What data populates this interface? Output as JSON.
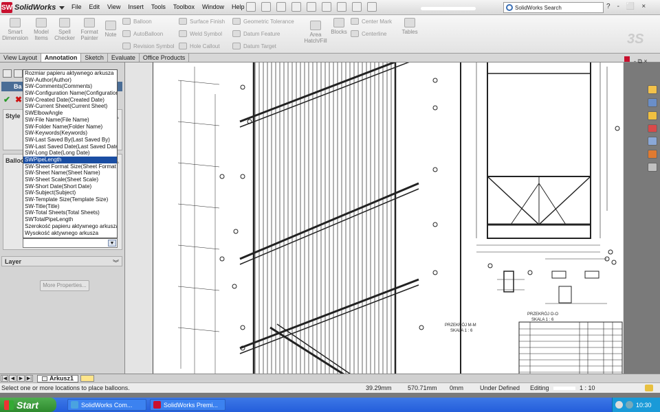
{
  "app": {
    "logo_text": "SolidWorks",
    "search_placeholder": "SolidWorks Search",
    "win_buttons": [
      "?",
      "-",
      "⬜",
      "×"
    ]
  },
  "menu": [
    "File",
    "Edit",
    "View",
    "Insert",
    "Tools",
    "Toolbox",
    "Window",
    "Help"
  ],
  "ribbon": {
    "big": [
      {
        "name": "smart-dimension",
        "label": "Smart Dimension"
      },
      {
        "name": "model-items",
        "label": "Model Items"
      },
      {
        "name": "spell-checker",
        "label": "Spell Checker"
      },
      {
        "name": "format-painter",
        "label": "Format Painter"
      },
      {
        "name": "note",
        "label": "Note"
      }
    ],
    "small": [
      "Balloon",
      "AutoBalloon",
      "Revision Symbol",
      "Surface Finish",
      "Weld Symbol",
      "Hole Callout",
      "Geometric Tolerance",
      "Datum Feature",
      "Datum Target",
      "Area Hatch/Fill",
      "Blocks",
      "Center Mark",
      "Centerline",
      "Tables"
    ]
  },
  "tabs": [
    "View Layout",
    "Annotation",
    "Sketch",
    "Evaluate",
    "Office Products"
  ],
  "active_tab": "Annotation",
  "panel": {
    "title": "Ba",
    "style_label": "Style",
    "balloon_label": "Balloon",
    "layer_label": "Layer",
    "more_properties": "More Properties..."
  },
  "dropdown": {
    "options": [
      "Rozmiar papieru aktywnego arkusza",
      "SW-Author(Author)",
      "SW-Comments(Comments)",
      "SW-Configuration Name(Configuration",
      "SW-Created Date(Created Date)",
      "SW-Current Sheet(Current Sheet)",
      "SWElbowAngle",
      "SW-File Name(File Name)",
      "SW-Folder Name(Folder Name)",
      "SW-Keywords(Keywords)",
      "SW-Last Saved By(Last Saved By)",
      "SW-Last Saved Date(Last Saved Date",
      "SW-Long Date(Long Date)",
      "SWPipeLength",
      "SW-Sheet Format Size(Sheet Format",
      "SW-Sheet Name(Sheet Name)",
      "SW-Sheet Scale(Sheet Scale)",
      "SW-Short Date(Short Date)",
      "SW-Subject(Subject)",
      "SW-Template Size(Template Size)",
      "SW-Title(Title)",
      "SW-Total Sheets(Total Sheets)",
      "SWTotalPipeLength",
      "Szerokość papieru aktywnego arkusza",
      "Wysokość aktywnego arkusza"
    ],
    "selected": "SWPipeLength"
  },
  "drawing_labels": {
    "section1": "PRZEKRÓJ M-M",
    "scale1": "SKALA 1 : 6",
    "section2": "PRZEKRÓJ O-O",
    "scale2": "SKALA 1 : 6"
  },
  "sheet_tab": "Arkusz1",
  "status": {
    "message": "Select one or more locations to place balloons.",
    "x": "39.29mm",
    "y": "570.71mm",
    "z": "0mm",
    "state": "Under Defined",
    "editing": "Editing",
    "scale": "1 : 10"
  },
  "taskbar": {
    "start": "Start",
    "items": [
      "SolidWorks Com...",
      "SolidWorks Premi..."
    ],
    "clock": "10:30"
  },
  "colors": {
    "selection": "#1a4ea3",
    "panel_title": "#4a6d96",
    "taskbar": "#245edb",
    "start": "#2e8a2e"
  }
}
